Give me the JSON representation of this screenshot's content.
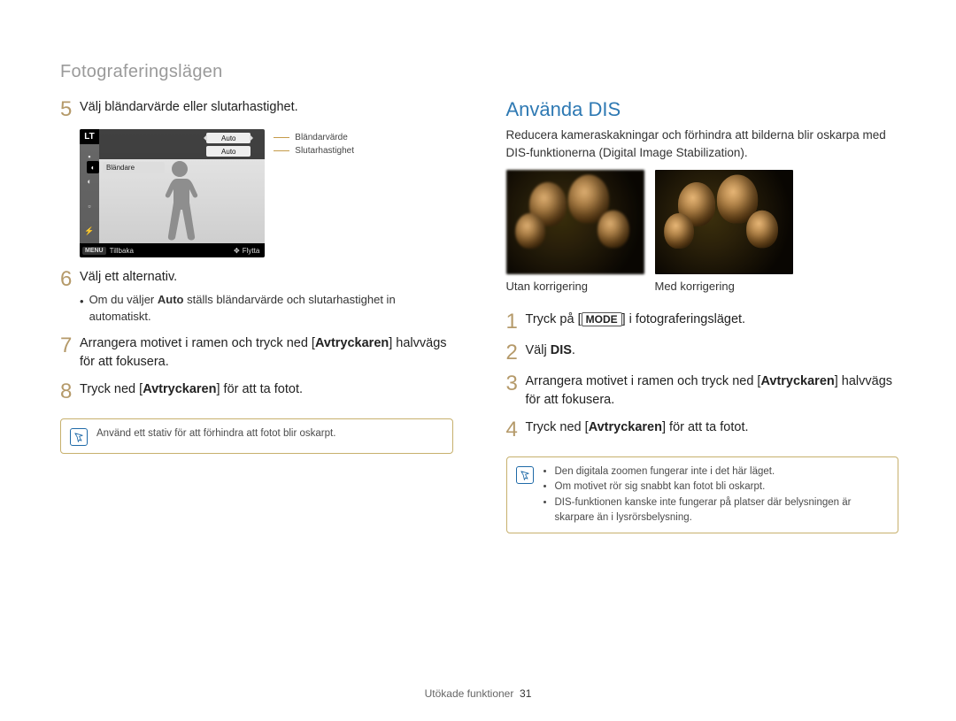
{
  "header": {
    "section": "Fotograferingslägen"
  },
  "cam": {
    "lt": "LT",
    "auto": "Auto",
    "blandare": "Bländare",
    "blandare_icon": "◐",
    "menu": "MENU",
    "back": "Tillbaka",
    "move": "Flytta",
    "label_aperture": "Bländarvärde",
    "label_shutter": "Slutarhastighet"
  },
  "left_steps": {
    "n5": "5",
    "t5": "Välj bländarvärde eller slutarhastighet.",
    "n6": "6",
    "t6": "Välj ett alternativ.",
    "s6_prefix": "Om du väljer ",
    "s6_bold": "Auto",
    "s6_suffix": " ställs bländarvärde och slutarhastighet in automatiskt.",
    "n7": "7",
    "t7_a": "Arrangera motivet i ramen och tryck ned [",
    "t7_b": "Avtryckaren",
    "t7_c": "] halvvägs för att fokusera.",
    "n8": "8",
    "t8_a": "Tryck ned [",
    "t8_b": "Avtryckaren",
    "t8_c": "] för att ta fotot."
  },
  "left_note": "Använd ett stativ för att förhindra att fotot blir oskarpt.",
  "right": {
    "title": "Använda DIS",
    "intro": "Reducera kameraskakningar och förhindra att bilderna blir oskarpa med DIS-funktionerna (Digital Image Stabilization).",
    "cap_left": "Utan korrigering",
    "cap_right": "Med korrigering"
  },
  "right_steps": {
    "n1": "1",
    "t1_a": "Tryck på [",
    "t1_b": "MODE",
    "t1_c": "] i fotograferingsläget.",
    "n2": "2",
    "t2_a": "Välj ",
    "t2_b": "DIS",
    "t2_c": ".",
    "n3": "3",
    "t3_a": "Arrangera motivet i ramen och tryck ned [",
    "t3_b": "Avtryckaren",
    "t3_c": "] halvvägs för att fokusera.",
    "n4": "4",
    "t4_a": "Tryck ned [",
    "t4_b": "Avtryckaren",
    "t4_c": "] för att ta fotot."
  },
  "right_note": {
    "b1": "Den digitala zoomen fungerar inte i det här läget.",
    "b2": "Om motivet rör sig snabbt kan fotot bli oskarpt.",
    "b3": "DIS-funktionen kanske inte fungerar på platser där belysningen är skarpare än i lysrörsbelysning."
  },
  "footer": {
    "label": "Utökade funktioner",
    "page": "31"
  }
}
